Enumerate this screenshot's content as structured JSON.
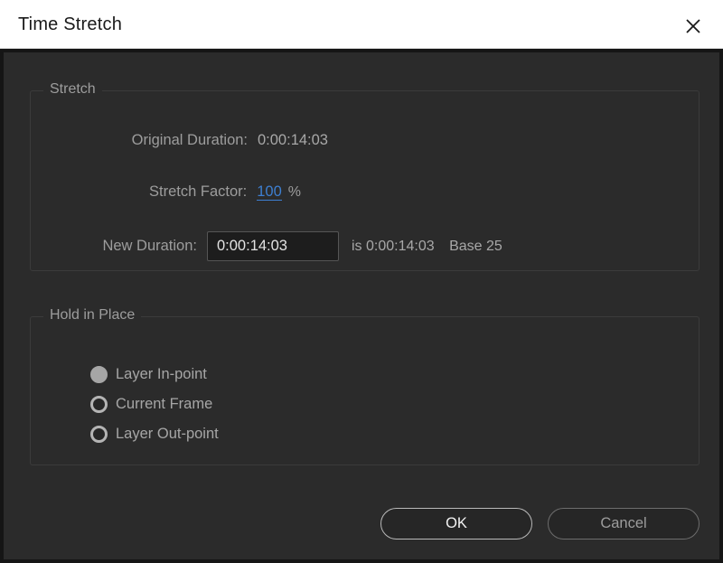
{
  "titlebar": {
    "title": "Time Stretch",
    "close_icon": "close-icon"
  },
  "stretch_group": {
    "legend": "Stretch",
    "original_duration": {
      "label": "Original Duration:",
      "value": "0:00:14:03"
    },
    "stretch_factor": {
      "label": "Stretch Factor:",
      "value": "100",
      "unit": "%"
    },
    "new_duration": {
      "label": "New Duration:",
      "value": "0:00:14:03",
      "placeholder": "0:00:00:00",
      "is_text": "is 0:00:14:03",
      "base_text": "Base 25"
    }
  },
  "hold_group": {
    "legend": "Hold in Place",
    "options": [
      {
        "label": "Layer In-point",
        "selected": true
      },
      {
        "label": "Current Frame",
        "selected": false
      },
      {
        "label": "Layer Out-point",
        "selected": false
      }
    ]
  },
  "footer": {
    "ok_label": "OK",
    "cancel_label": "Cancel"
  },
  "colors": {
    "titlebar_bg": "#ffffff",
    "titlebar_text": "#1a1a1a",
    "panel_bg": "#2b2b2b",
    "panel_border": "#151515",
    "group_border": "#3b3b3b",
    "label_text": "#9d9d9d",
    "value_text": "#a8a8a8",
    "hot_value": "#3d7fd1",
    "input_bg": "#1d1d1d",
    "input_border": "#555555",
    "radio_on": "#a6a6a6",
    "btn_primary_border": "#b9b9b9",
    "btn_secondary_border": "#6d6d6d"
  }
}
